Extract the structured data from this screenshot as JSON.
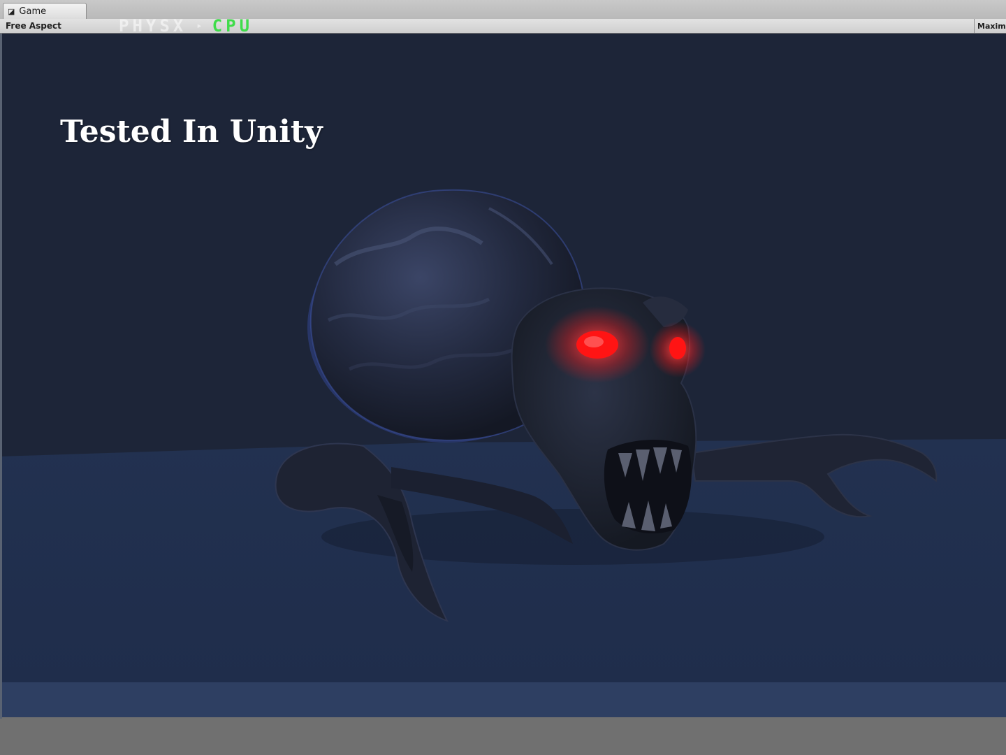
{
  "tab": {
    "label": "Game",
    "icon": "game-view-icon"
  },
  "toolbar": {
    "aspect_label": "Free Aspect",
    "physx_label": "PHYSX",
    "physx_arrow": "▸",
    "cpu_label": "CPU",
    "maximize_label": "Maxim"
  },
  "viewport": {
    "overlay_title": "Tested In Unity"
  },
  "colors": {
    "sky": "#1d2538",
    "ground": "#223150",
    "eyes": "#ff1a1a",
    "cpu_text": "#3fdc4a",
    "editor_floor": "#707070"
  }
}
